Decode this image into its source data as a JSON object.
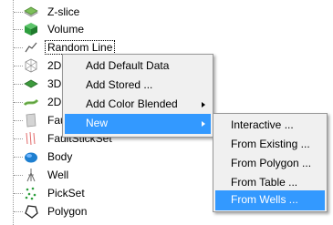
{
  "tree": {
    "items": [
      {
        "label": "Z-slice",
        "icon": "z-slice-icon"
      },
      {
        "label": "Volume",
        "icon": "volume-cube-icon"
      },
      {
        "label": "Random Line",
        "icon": "random-line-icon"
      },
      {
        "label": "2D",
        "icon": "2d-wireframe-icon"
      },
      {
        "label": "3D",
        "icon": "3d-horizon-icon"
      },
      {
        "label": "2D",
        "icon": "2d-horizon-icon"
      },
      {
        "label": "Faul",
        "icon": "fault-icon"
      },
      {
        "label": "FaultStickSet",
        "icon": "fault-stick-set-icon"
      },
      {
        "label": "Body",
        "icon": "body-icon"
      },
      {
        "label": "Well",
        "icon": "well-icon"
      },
      {
        "label": "PickSet",
        "icon": "pickset-icon"
      },
      {
        "label": "Polygon",
        "icon": "polygon-icon"
      }
    ]
  },
  "context_menu": {
    "items": [
      {
        "label": "Add Default Data",
        "submenu": false
      },
      {
        "label": "Add Stored ...",
        "submenu": false
      },
      {
        "label": "Add Color Blended",
        "submenu": true
      },
      {
        "label": "New",
        "submenu": true
      }
    ],
    "highlighted": "New"
  },
  "sub_menu": {
    "items": [
      {
        "label": "Interactive  ..."
      },
      {
        "label": "From Existing ..."
      },
      {
        "label": "From Polygon ..."
      },
      {
        "label": "From Table ..."
      },
      {
        "label": "From Wells ..."
      }
    ],
    "highlighted": "From Wells ..."
  },
  "colors": {
    "highlight": "#3399ff",
    "menu_background": "#f0f0f0",
    "volume_green": "#2e9e3e",
    "body_blue": "#1e7fd0"
  }
}
